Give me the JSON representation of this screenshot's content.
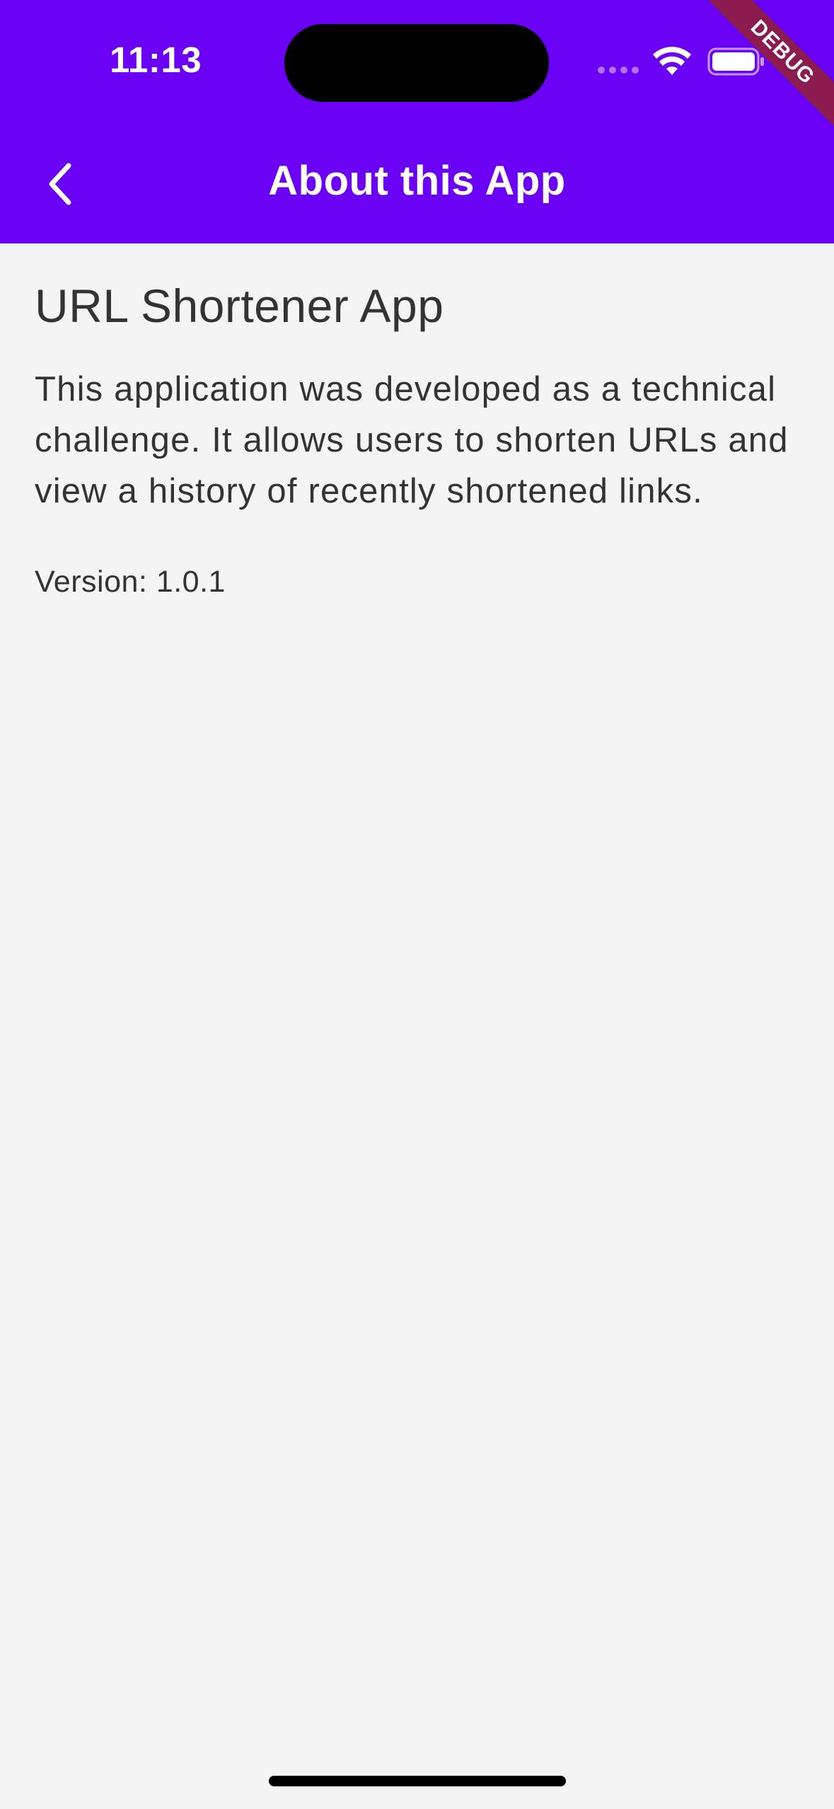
{
  "status_bar": {
    "time": "11:13",
    "wifi_icon": "wifi-icon",
    "battery_icon": "battery-icon"
  },
  "debug_banner": {
    "label": "DEBUG",
    "color": "#8b1a4e"
  },
  "app_bar": {
    "back_icon": "chevron-left-icon",
    "title": "About this App",
    "background_color": "#6a00f4"
  },
  "content": {
    "app_name": "URL Shortener App",
    "description": "This application was developed as a technical challenge. It allows users to shorten URLs and view a history of recently shortened links.",
    "version": "Version: 1.0.1"
  }
}
